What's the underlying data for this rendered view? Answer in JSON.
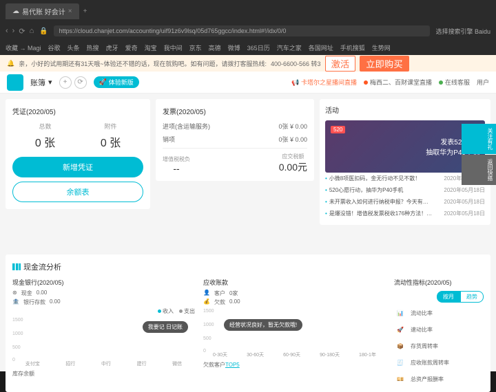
{
  "browser": {
    "tabs": [
      {
        "title": "易代账 好会计",
        "icon": "☁"
      }
    ],
    "url": "https://cloud.chanjet.com/accounting/uif91z6v9lsq/05d765ggcc/index.html#!/idx/0/0",
    "search_engine": "选择搜索引擎 Baidu",
    "bookmarks": [
      "收藏 → Magi",
      "谷歌",
      "头条",
      "热搜",
      "虎牙",
      "爱奇",
      "淘宝",
      "我中间",
      "京东",
      "高德",
      "微博",
      "365日历",
      "汽车之家",
      "各国网址",
      "手机搜狐",
      "生势网"
    ]
  },
  "notice": {
    "text": "亲，小好的试用期还有31天哦~体验还不错的话，现在就购吧。如有问题，请拨打客服热线:",
    "phone": "400-6600-566 转3",
    "btn_buy": "激活",
    "btn_activate": "立即购买"
  },
  "header": {
    "account": "账簿",
    "badge": "体验新版",
    "live_notice": "卡塔尔之星播间直播",
    "links": [
      "梅西二、百财课堂直播",
      "在线客服",
      "用户"
    ]
  },
  "voucher": {
    "title": "凭证(2020/05)",
    "stats": [
      {
        "label": "总数",
        "value": "0 张"
      },
      {
        "label": "附件",
        "value": "0 张"
      }
    ],
    "btn_new": "新增凭证",
    "btn_balance": "余额表"
  },
  "invoice": {
    "title": "发票(2020/05)",
    "purchase": {
      "label": "进项(含运输服务)",
      "count": "0张",
      "amount": "¥ 0.00"
    },
    "sales": {
      "label": "销项",
      "count": "0张",
      "amount": "¥ 0.00"
    },
    "vat": {
      "label": "增值税税负",
      "value": "--"
    },
    "payable": {
      "label": "应交税额",
      "value": "0.00元"
    }
  },
  "activity": {
    "title": "活动",
    "promo": {
      "tag": "520",
      "line1": "发表520心愿",
      "line2": "抽取华为P40手机"
    },
    "items": [
      {
        "text": "小微8项医扣码，金无行动不见不散！",
        "date": "2020年05月18日"
      },
      {
        "text": "520心愿行动，抽华为P40手机",
        "date": "2020年05月18日"
      },
      {
        "text": "未开票收入如何进行纳税申报？今天有…",
        "date": "2020年05月18日"
      },
      {
        "text": "是爆没错！增值税发票税收176种方法！…",
        "date": "2020年05月18日"
      }
    ]
  },
  "analysis": {
    "title": "现金流分析",
    "cash": {
      "title": "现金银行(2020/05)",
      "items": [
        {
          "icon": "¥",
          "label": "现金",
          "value": "0.00"
        },
        {
          "icon": "🏦",
          "label": "银行存款",
          "value": "0.00"
        }
      ],
      "legend": [
        "收入",
        "支出"
      ],
      "pill_text": "我要记 日记账",
      "xlabels": [
        "支付宝",
        "招行",
        "中行",
        "建行",
        "微信"
      ],
      "footer": "库存余额"
    },
    "receivable": {
      "title": "应收账款",
      "stats": [
        {
          "icon": "👤",
          "label": "客户",
          "value": "0家"
        },
        {
          "icon": "💰",
          "label": "欠款",
          "value": "0.00"
        }
      ],
      "pill_text": "经营状况良好，暂无欠款哦!",
      "xlabels": [
        "0-30天",
        "30-60天",
        "60-90天",
        "90-180天",
        "180-1年"
      ],
      "footer_prefix": "欠款客户",
      "footer_link": "TOP5"
    },
    "liquidity": {
      "title": "流动性指标(2020/05)",
      "toggle": [
        "按月",
        "趋势"
      ],
      "metrics": [
        "流动比率",
        "速动比率",
        "存货周转率",
        "应收账款周转率",
        "总资产报酬率"
      ]
    }
  },
  "side_tabs": [
    "关注有礼",
    "返回快搭"
  ],
  "chart_data": [
    {
      "type": "bar",
      "title": "现金银行(2020/05)",
      "categories": [
        "支付宝",
        "招行",
        "中行",
        "建行",
        "微信"
      ],
      "series": [
        {
          "name": "收入",
          "values": [
            0,
            0,
            0,
            0,
            0
          ]
        },
        {
          "name": "支出",
          "values": [
            0,
            0,
            0,
            0,
            0
          ]
        }
      ],
      "ylabel": "",
      "ylim": [
        0,
        1500
      ],
      "yticks": [
        0,
        500,
        1000,
        1500
      ]
    },
    {
      "type": "bar",
      "title": "应收账款",
      "categories": [
        "0-30天",
        "30-60天",
        "60-90天",
        "90-180天",
        "180-1年"
      ],
      "values": [
        0,
        0,
        0,
        0,
        0
      ],
      "ylabel": "",
      "ylim": [
        0,
        1500
      ],
      "yticks": [
        0,
        500,
        1000,
        1500
      ]
    }
  ]
}
